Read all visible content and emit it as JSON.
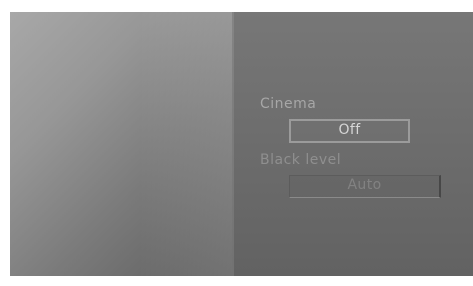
{
  "menu": {
    "cinema": {
      "label": "Cinema",
      "value": "Off"
    },
    "black_level": {
      "label": "Black level",
      "value": "Auto"
    }
  }
}
